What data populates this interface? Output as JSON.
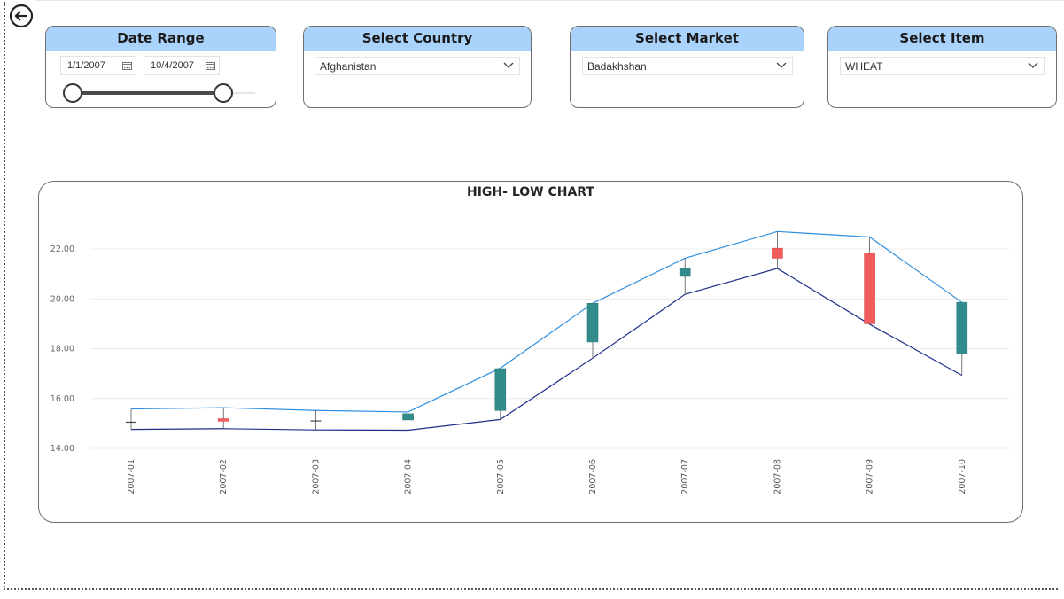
{
  "filters": {
    "date_range": {
      "title": "Date Range",
      "start": "1/1/2007",
      "end": "10/4/2007"
    },
    "country": {
      "title": "Select Country",
      "value": "Afghanistan"
    },
    "market": {
      "title": "Select Market",
      "value": "Badakhshan"
    },
    "item": {
      "title": "Select Item",
      "value": "WHEAT"
    }
  },
  "icons": {
    "back": "back-arrow-icon",
    "calendar": "calendar-icon",
    "dropdown": "chevron-down-icon"
  },
  "colors": {
    "header_bg": "#a9d3fb",
    "high_line": "#2e8fe0",
    "low_line": "#1f2f8a",
    "up_candle": "#328c8c",
    "down_candle": "#f25c5c"
  },
  "chart_data": {
    "type": "candlestick",
    "title": "HIGH- LOW CHART",
    "categories": [
      "2007-01",
      "2007-02",
      "2007-03",
      "2007-04",
      "2007-05",
      "2007-06",
      "2007-07",
      "2007-08",
      "2007-09",
      "2007-10"
    ],
    "ylim": [
      14,
      23
    ],
    "yticks": [
      "14.00",
      "16.00",
      "18.00",
      "20.00",
      "22.00"
    ],
    "grid": true,
    "high": [
      15.58,
      15.63,
      15.52,
      15.46,
      17.22,
      19.82,
      21.63,
      22.7,
      22.48,
      19.86
    ],
    "low": [
      14.76,
      14.79,
      14.74,
      14.73,
      15.16,
      17.62,
      20.18,
      21.22,
      18.98,
      16.93
    ],
    "open": [
      15.05,
      15.19,
      15.1,
      15.14,
      15.52,
      18.27,
      20.9,
      22.03,
      21.82,
      17.78
    ],
    "close": [
      15.05,
      15.09,
      15.1,
      15.39,
      17.2,
      19.82,
      21.22,
      21.63,
      19.0,
      19.86
    ]
  }
}
